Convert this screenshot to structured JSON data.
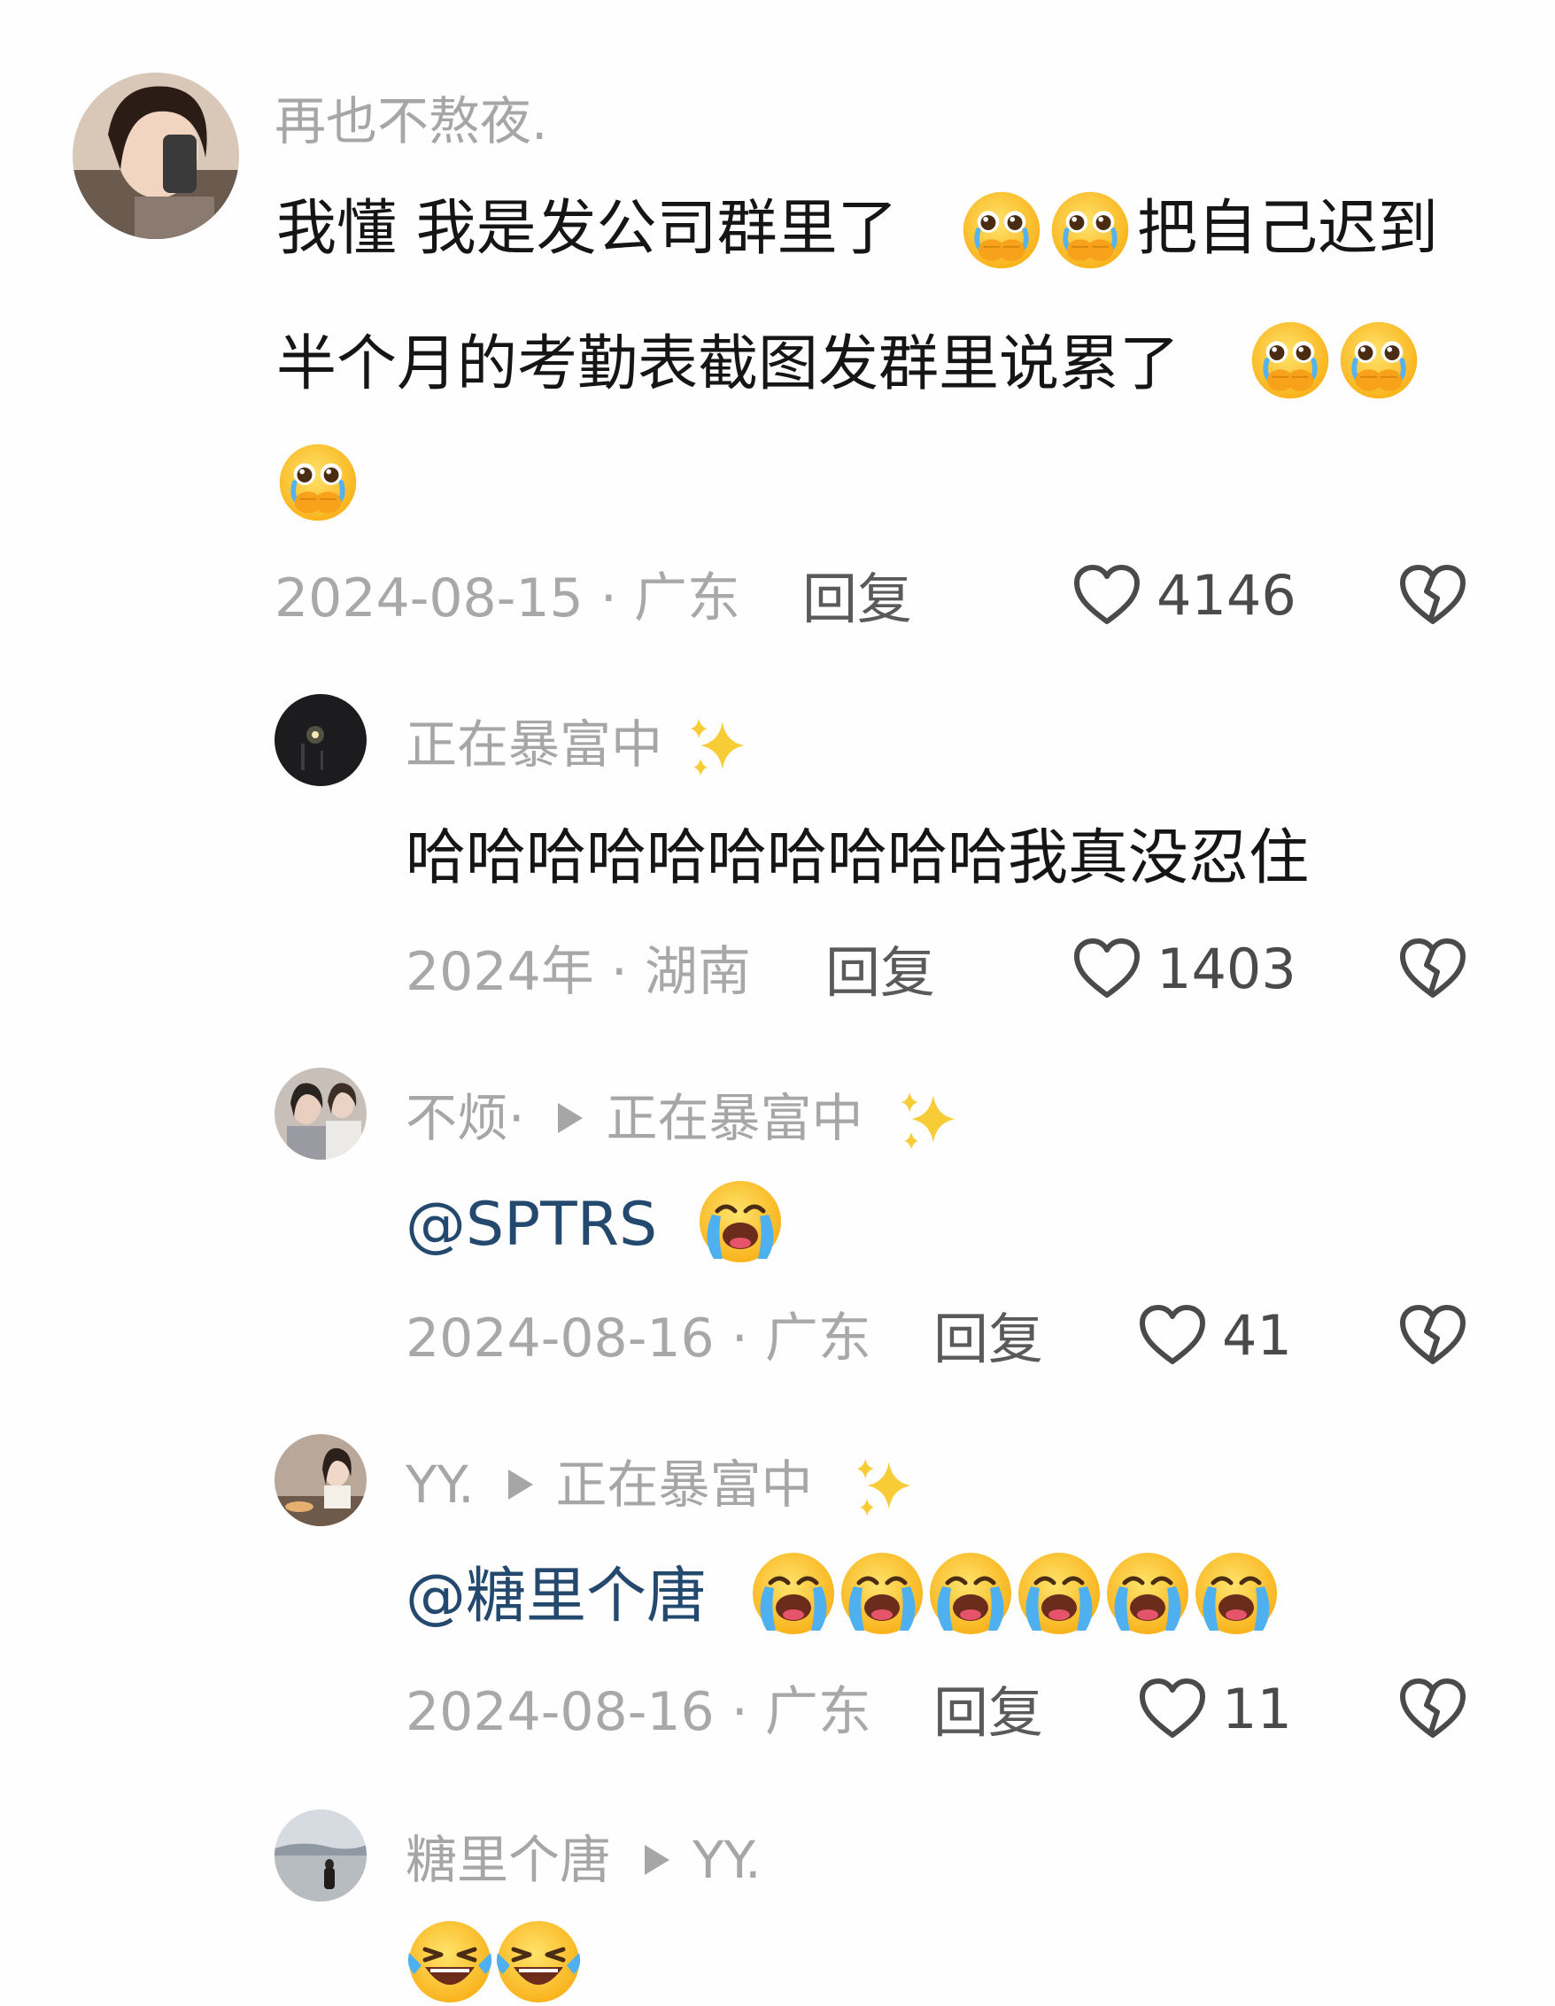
{
  "comments": [
    {
      "username": "再也不熬夜.",
      "text_line1": "我懂  我是发公司群里了",
      "text_line1b": "把自己迟到",
      "text_line2": "半个月的考勤表截图发群里说累了",
      "emojis": [
        "pleading-crying-face",
        "pleading-crying-face",
        "pleading-crying-face",
        "pleading-crying-face",
        "pleading-crying-face"
      ],
      "date_location": "2024-08-15 · 广东",
      "reply_label": "回复",
      "likes": "4146"
    },
    {
      "username": "正在暴富中",
      "text": "哈哈哈哈哈哈哈哈哈哈我真没忍住",
      "date_location": "2024年 · 湖南",
      "reply_label": "回复",
      "likes": "1403"
    },
    {
      "username": "不烦·",
      "reply_to": "正在暴富中",
      "mention": "@SPTRS",
      "emojis": [
        "loudly-crying-face"
      ],
      "date_location": "2024-08-16 · 广东",
      "reply_label": "回复",
      "likes": "41"
    },
    {
      "username": "YY.",
      "reply_to": "正在暴富中",
      "mention": "@糖里个唐",
      "emojis": [
        "loudly-crying-face",
        "loudly-crying-face",
        "loudly-crying-face",
        "loudly-crying-face",
        "loudly-crying-face",
        "loudly-crying-face"
      ],
      "date_location": "2024-08-16 · 广东",
      "reply_label": "回复",
      "likes": "11"
    },
    {
      "username": "糖里个唐",
      "reply_to": "YY.",
      "emojis": [
        "laughing-tears-face",
        "laughing-tears-face"
      ]
    }
  ],
  "icons": {
    "like": "heart-outline-icon",
    "dislike": "broken-heart-outline-icon",
    "sparkle": "sparkles-icon"
  },
  "colors": {
    "username": "#a6a6a6",
    "mention": "#23496f",
    "meta": "#a8a8a8"
  }
}
